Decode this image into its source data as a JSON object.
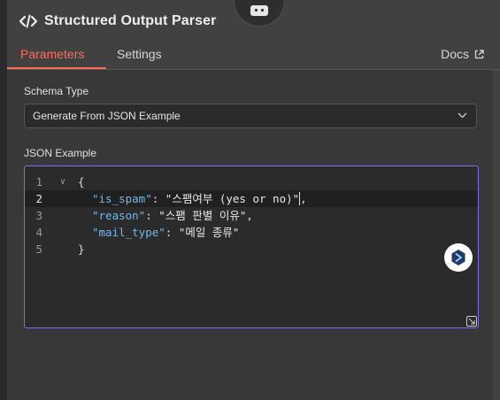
{
  "node": {
    "title": "Structured Output Parser",
    "badge_icon": "robot-icon"
  },
  "tabs": [
    {
      "label": "Parameters",
      "active": true
    },
    {
      "label": "Settings",
      "active": false
    }
  ],
  "docs_label": "Docs",
  "schema_type": {
    "label": "Schema Type",
    "value": "Generate From JSON Example"
  },
  "json_example": {
    "label": "JSON Example",
    "lines": [
      {
        "number": "1",
        "text": "{"
      },
      {
        "number": "2",
        "key": "\"is_spam\"",
        "value": "\"스팸여부 (yes or no)\"",
        "suffix": ","
      },
      {
        "number": "3",
        "key": "\"reason\"",
        "value": "\"스팸 판별 이유\"",
        "suffix": ","
      },
      {
        "number": "4",
        "key": "\"mail_type\"",
        "value": "\"메일 종류\"",
        "suffix": ""
      },
      {
        "number": "5",
        "text": "}"
      }
    ],
    "active_line": 2
  },
  "colors": {
    "accent": "#ff6d5a",
    "focus_border": "#7c6cf2",
    "json_key": "#73b9ea"
  }
}
